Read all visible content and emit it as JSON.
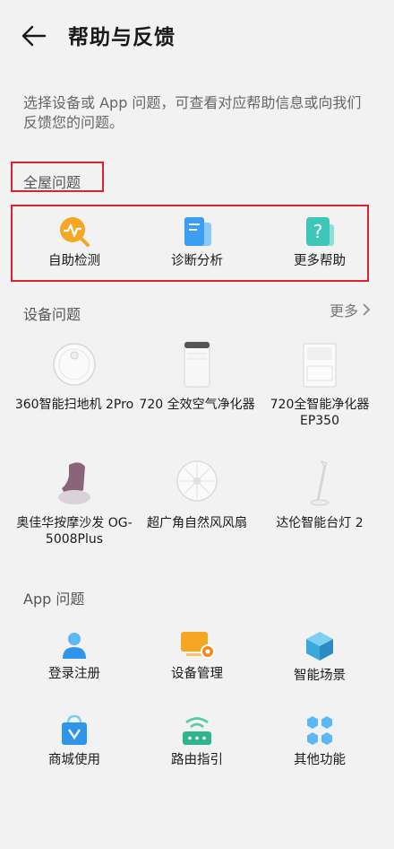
{
  "header": {
    "title": "帮助与反馈"
  },
  "intro": "选择设备或 App 问题，可查看对应帮助信息或向我们反馈您的问题。",
  "whole_home": {
    "label": "全屋问题",
    "items": [
      {
        "label": "自助检测",
        "icon": "self-check-icon"
      },
      {
        "label": "诊断分析",
        "icon": "diagnosis-icon"
      },
      {
        "label": "更多帮助",
        "icon": "more-help-icon"
      }
    ]
  },
  "devices": {
    "label": "设备问题",
    "more_label": "更多",
    "items": [
      {
        "label": "360智能扫地机 2Pro",
        "icon": "robot-vacuum-icon"
      },
      {
        "label": "720 全效空气净化器",
        "icon": "air-purifier-icon"
      },
      {
        "label": "720全智能净化器 EP350",
        "icon": "purifier-ep350-icon"
      },
      {
        "label": "奥佳华按摩沙发 OG-5008Plus",
        "icon": "massage-sofa-icon"
      },
      {
        "label": "超广角自然风风扇",
        "icon": "fan-icon"
      },
      {
        "label": "达伦智能台灯 2",
        "icon": "desk-lamp-icon"
      }
    ]
  },
  "app": {
    "label": "App 问题",
    "items": [
      {
        "label": "登录注册",
        "icon": "user-icon"
      },
      {
        "label": "设备管理",
        "icon": "device-manage-icon"
      },
      {
        "label": "智能场景",
        "icon": "scene-cube-icon"
      },
      {
        "label": "商城使用",
        "icon": "shopping-bag-icon"
      },
      {
        "label": "路由指引",
        "icon": "router-icon"
      },
      {
        "label": "其他功能",
        "icon": "other-functions-icon"
      }
    ]
  },
  "colors": {
    "accent_teal": "#3ec6b8",
    "accent_blue": "#3b9ef0",
    "accent_orange": "#f5a623",
    "highlight_red": "#d9232e"
  }
}
